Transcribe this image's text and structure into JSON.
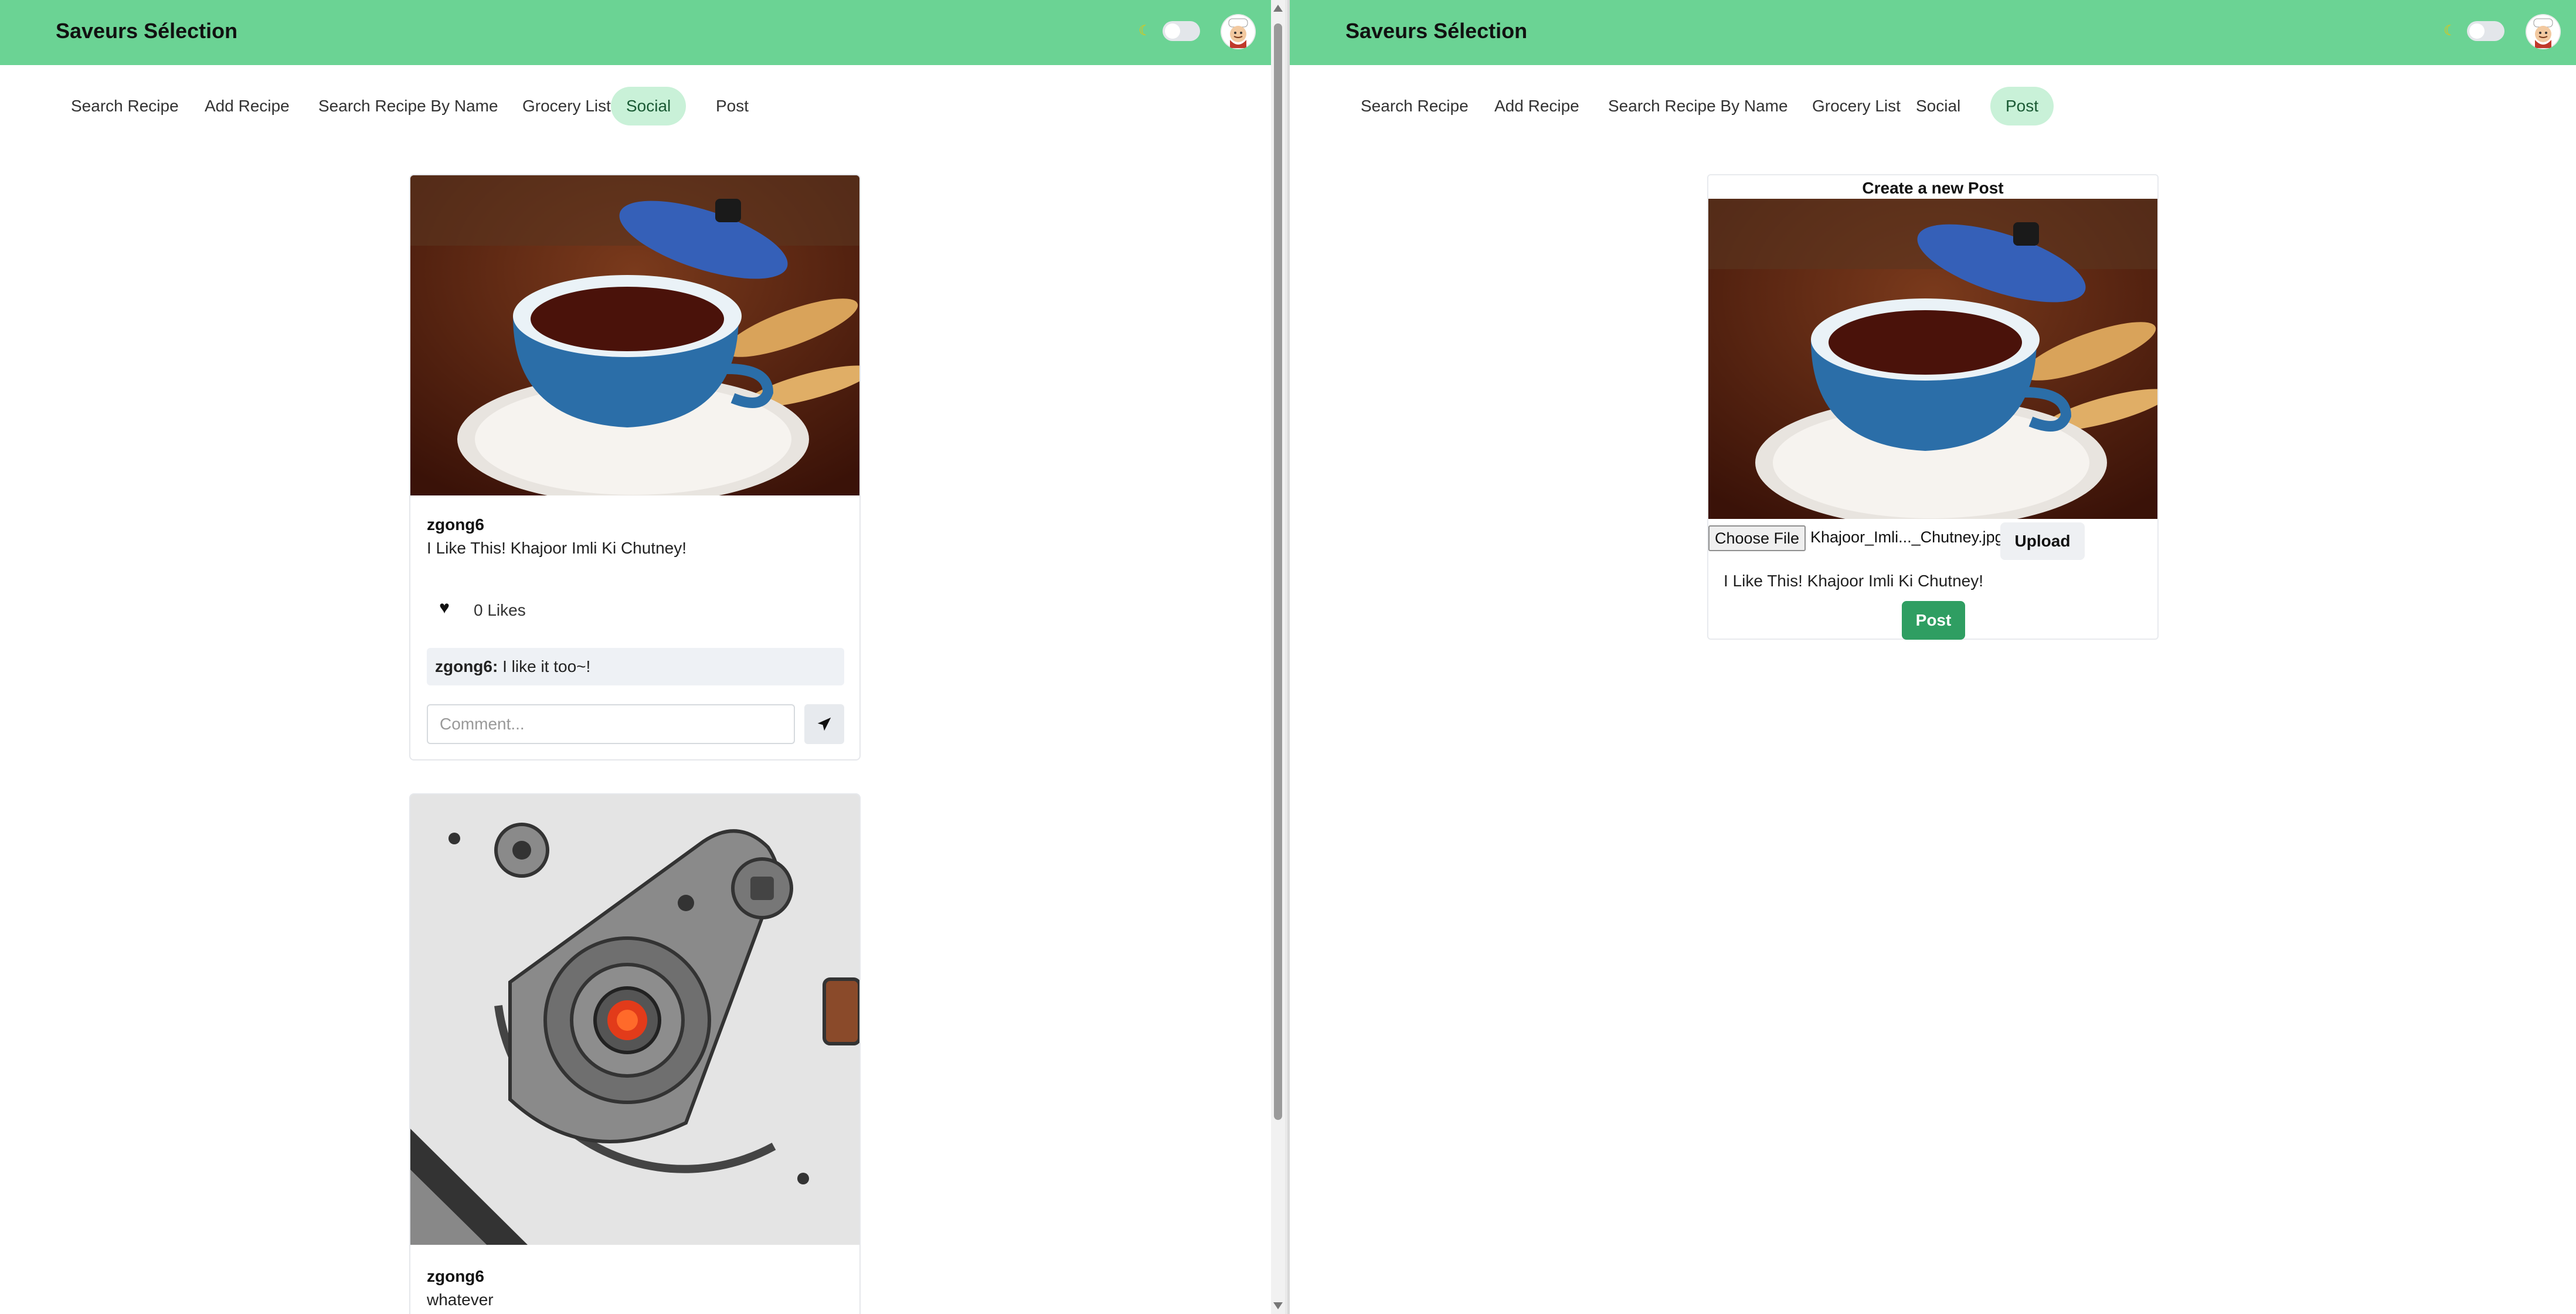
{
  "app": {
    "title": "Saveurs Sélection",
    "accent_color": "#6bd394",
    "active_tab_color": "#c9f1d8"
  },
  "nav": {
    "tabs": [
      {
        "label": "Search Recipe"
      },
      {
        "label": "Add Recipe"
      },
      {
        "label": "Search Recipe By Name"
      },
      {
        "label": "Grocery List"
      },
      {
        "label": "Social"
      },
      {
        "label": "Post"
      }
    ]
  },
  "left": {
    "active_tab": "Social",
    "posts": [
      {
        "user": "zgong6",
        "caption": "I Like This! Khajoor Imli Ki Chutney!",
        "likes": "0 Likes",
        "image": "chocolate-pot-photo",
        "comments": [
          {
            "user": "zgong6:",
            "text": "I like it too~!"
          }
        ],
        "comment_placeholder": "Comment..."
      },
      {
        "user": "zgong6",
        "caption": "whatever",
        "image": "turntable-illustration"
      }
    ]
  },
  "right": {
    "active_tab": "Post",
    "form": {
      "title": "Create a new Post",
      "choose_file_label": "Choose File",
      "file_name": "Khajoor_Imli..._Chutney.jpg",
      "upload_label": "Upload",
      "caption": "I Like This! Khajoor Imli Ki Chutney!",
      "post_label": "Post",
      "post_button_color": "#2f9e62"
    }
  }
}
